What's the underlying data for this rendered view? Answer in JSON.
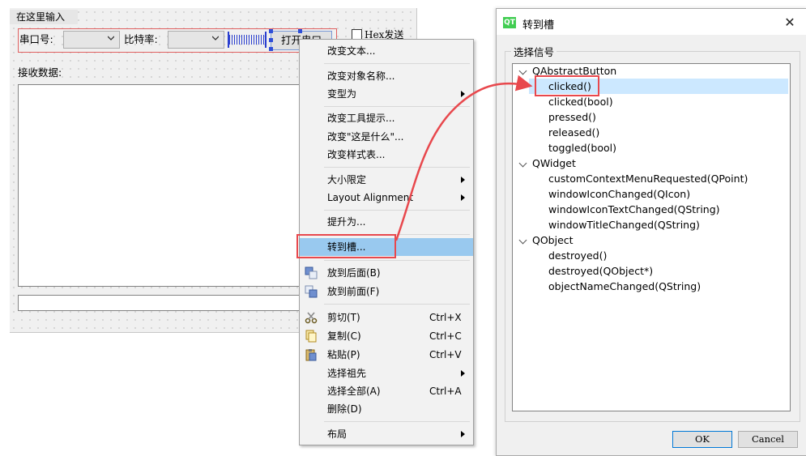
{
  "form": {
    "menu_input": "在这里输入",
    "port_label": "串口号:",
    "baud_label": "比特率:",
    "open_button": "打开串口",
    "hex_send": "Hex发送",
    "recv_label": "接收数据:"
  },
  "context_menu": {
    "items": [
      {
        "label": "改变文本..."
      },
      {
        "label": "改变对象名称..."
      },
      {
        "label": "变型为"
      },
      {
        "label": "改变工具提示..."
      },
      {
        "label": "改变\"这是什么\"..."
      },
      {
        "label": "改变样式表..."
      },
      {
        "label": "大小限定"
      },
      {
        "label": "Layout Alignment"
      },
      {
        "label": "提升为..."
      },
      {
        "label": "转到槽..."
      },
      {
        "label": "放到后面(B)"
      },
      {
        "label": "放到前面(F)"
      },
      {
        "label": "剪切(T)",
        "shortcut": "Ctrl+X"
      },
      {
        "label": "复制(C)",
        "shortcut": "Ctrl+C"
      },
      {
        "label": "粘贴(P)",
        "shortcut": "Ctrl+V"
      },
      {
        "label": "选择祖先"
      },
      {
        "label": "选择全部(A)",
        "shortcut": "Ctrl+A"
      },
      {
        "label": "删除(D)"
      },
      {
        "label": "布局"
      }
    ]
  },
  "dialog": {
    "icon_text": "QT",
    "title": "转到槽",
    "group_title": "选择信号",
    "tree": {
      "groups": [
        {
          "name": "QAbstractButton",
          "signals": [
            "clicked()",
            "clicked(bool)",
            "pressed()",
            "released()",
            "toggled(bool)"
          ]
        },
        {
          "name": "QWidget",
          "signals": [
            "customContextMenuRequested(QPoint)",
            "windowIconChanged(QIcon)",
            "windowIconTextChanged(QString)",
            "windowTitleChanged(QString)"
          ]
        },
        {
          "name": "QObject",
          "signals": [
            "destroyed()",
            "destroyed(QObject*)",
            "objectNameChanged(QString)"
          ]
        }
      ]
    },
    "ok": "OK",
    "cancel": "Cancel"
  },
  "colors": {
    "highlight": "#99c9ef",
    "selection": "#cce8ff",
    "annotation": "#e8484d",
    "qt_green": "#41cd52"
  }
}
